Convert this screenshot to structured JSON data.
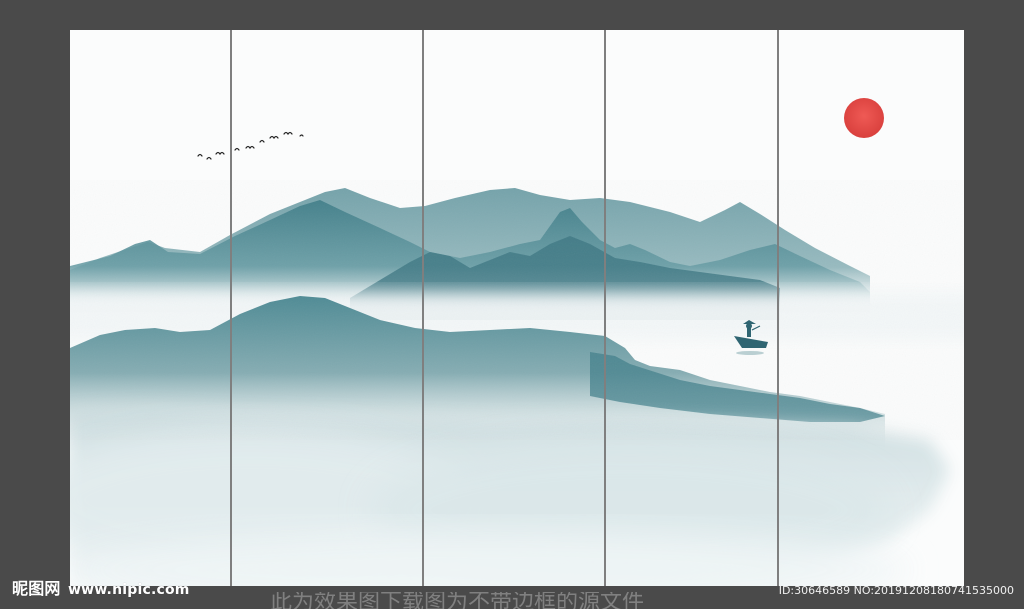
{
  "colors": {
    "frame": "#4a4a4a",
    "canvas": "#fbfcfc",
    "mountain_dark": "#3f7d88",
    "mountain_mid": "#6a9ea6",
    "mist": "#c6d8db",
    "sun": "#e8504e",
    "panel_divider": "#7a7a7a"
  },
  "artwork": {
    "panel_count": 5,
    "elements": [
      "mountain-range-icon",
      "sun-icon",
      "birds-icon",
      "boat-icon"
    ]
  },
  "watermark": {
    "site_brand": "昵图网",
    "site_url": "www.nipic.com",
    "id_text": "ID:30646589 NO:20191208180741535000"
  },
  "bottom_note": "此为效果图下载图为不带边框的源文件"
}
